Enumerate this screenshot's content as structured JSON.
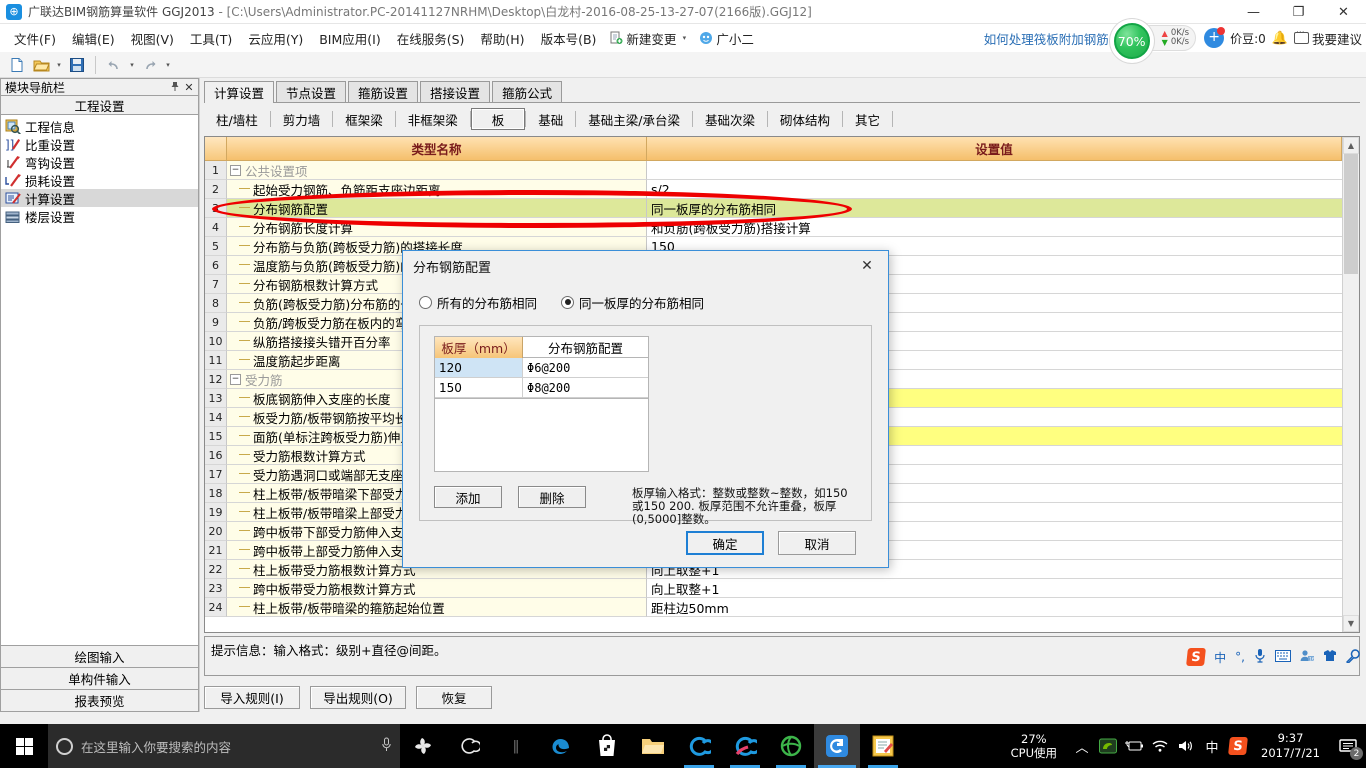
{
  "window": {
    "title_main": "广联达BIM钢筋算量软件 GGJ2013",
    "title_path": "- [C:\\Users\\Administrator.PC-20141127NRHM\\Desktop\\白龙村-2016-08-25-13-27-07(2166版).GGJ12]",
    "minimize": "—",
    "maximize": "❐",
    "close": "✕"
  },
  "menubar": {
    "items": [
      "文件(F)",
      "编辑(E)",
      "视图(V)",
      "工具(T)",
      "云应用(Y)",
      "BIM应用(I)",
      "在线服务(S)",
      "帮助(H)",
      "版本号(B)"
    ],
    "new_change": "新建变更",
    "new_change_caret": "▾",
    "assistant": "广小二",
    "hint_link": "如何处理筏板附加钢筋..",
    "net_up": "0K/s",
    "net_down": "0K/s",
    "gauge_percent": "70%",
    "bean_label": "价豆:0",
    "suggest_label": "我要建议"
  },
  "toolbar": {
    "new_icon": "new-file",
    "open_icon": "open-folder",
    "save_icon": "save-disk",
    "undo_icon": "undo-arrow",
    "redo_icon": "redo-arrow",
    "caret": "▾"
  },
  "sidebar": {
    "panel_title": "模块导航栏",
    "pin": "📌",
    "close": "✕",
    "section_title": "工程设置",
    "items": [
      {
        "label": "工程信息",
        "selected": false
      },
      {
        "label": "比重设置",
        "selected": false
      },
      {
        "label": "弯钩设置",
        "selected": false
      },
      {
        "label": "损耗设置",
        "selected": false
      },
      {
        "label": "计算设置",
        "selected": true
      },
      {
        "label": "楼层设置",
        "selected": false
      }
    ],
    "bottom_buttons": [
      "绘图输入",
      "单构件输入",
      "报表预览"
    ]
  },
  "tabs_primary": [
    {
      "label": "计算设置",
      "active": true
    },
    {
      "label": "节点设置",
      "active": false
    },
    {
      "label": "箍筋设置",
      "active": false
    },
    {
      "label": "搭接设置",
      "active": false
    },
    {
      "label": "箍筋公式",
      "active": false
    }
  ],
  "tabs_secondary": [
    {
      "label": "柱/墙柱",
      "active": false
    },
    {
      "label": "剪力墙",
      "active": false
    },
    {
      "label": "框架梁",
      "active": false
    },
    {
      "label": "非框架梁",
      "active": false
    },
    {
      "label": "板",
      "active": true
    },
    {
      "label": "基础",
      "active": false
    },
    {
      "label": "基础主梁/承台梁",
      "active": false
    },
    {
      "label": "基础次梁",
      "active": false
    },
    {
      "label": "砌体结构",
      "active": false
    },
    {
      "label": "其它",
      "active": false
    }
  ],
  "grid": {
    "col_name": "类型名称",
    "col_value": "设置值",
    "rows": [
      {
        "n": "1",
        "type": "group",
        "expander": "−",
        "name": "公共设置项",
        "value": ""
      },
      {
        "n": "2",
        "type": "item",
        "name": "起始受力钢筋、负筋距支座边距离",
        "value": "s/2"
      },
      {
        "n": "3",
        "type": "item",
        "name": "分布钢筋配置",
        "value": "同一板厚的分布筋相同",
        "state": "selected"
      },
      {
        "n": "4",
        "type": "item",
        "name": "分布钢筋长度计算",
        "value": "和负筋(跨板受力筋)搭接计算"
      },
      {
        "n": "5",
        "type": "item",
        "name": "分布筋与负筋(跨板受力筋)的搭接长度",
        "value": "150"
      },
      {
        "n": "6",
        "type": "item",
        "name": "温度筋与负筋(跨板受力筋)的搭接长度",
        "value": ""
      },
      {
        "n": "7",
        "type": "item",
        "name": "分布钢筋根数计算方式",
        "value": ""
      },
      {
        "n": "8",
        "type": "item",
        "name": "负筋(跨板受力筋)分布筋的长度计算",
        "value": ""
      },
      {
        "n": "9",
        "type": "item",
        "name": "负筋/跨板受力筋在板内的弯折长度",
        "value": ""
      },
      {
        "n": "10",
        "type": "item",
        "name": "纵筋搭接接头错开百分率",
        "value": ""
      },
      {
        "n": "11",
        "type": "item",
        "name": "温度筋起步距离",
        "value": ""
      },
      {
        "n": "12",
        "type": "group",
        "expander": "−",
        "name": "受力筋",
        "value": ""
      },
      {
        "n": "13",
        "type": "item",
        "name": "板底钢筋伸入支座的长度",
        "value": "",
        "state": "highlight"
      },
      {
        "n": "14",
        "type": "item",
        "name": "板受力筋/板带钢筋按平均长度计算",
        "value": ""
      },
      {
        "n": "15",
        "type": "item",
        "name": "面筋(单标注跨板受力筋)伸入支座的长度",
        "value": "",
        "state": "highlight"
      },
      {
        "n": "16",
        "type": "item",
        "name": "受力筋根数计算方式",
        "value": ""
      },
      {
        "n": "17",
        "type": "item",
        "name": "受力筋遇洞口或端部无支座时的弯折长度",
        "value": ""
      },
      {
        "n": "18",
        "type": "item",
        "name": "柱上板带/板带暗梁下部受力筋伸入支座的长度",
        "value": ""
      },
      {
        "n": "19",
        "type": "item",
        "name": "柱上板带/板带暗梁上部受力筋伸入支座的长度",
        "value": ""
      },
      {
        "n": "20",
        "type": "item",
        "name": "跨中板带下部受力筋伸入支座的长度",
        "value": ""
      },
      {
        "n": "21",
        "type": "item",
        "name": "跨中板带上部受力筋伸入支座的长度",
        "value": ""
      },
      {
        "n": "22",
        "type": "item",
        "name": "柱上板带受力筋根数计算方式",
        "value": "向上取整+1"
      },
      {
        "n": "23",
        "type": "item",
        "name": "跨中板带受力筋根数计算方式",
        "value": "向上取整+1"
      },
      {
        "n": "24",
        "type": "item",
        "name": "柱上板带/板带暗梁的箍筋起始位置",
        "value": "距柱边50mm"
      }
    ]
  },
  "tip": {
    "text": "提示信息：输入格式：级别+直径@间距。"
  },
  "footer_buttons": [
    "导入规则(I)",
    "导出规则(O)",
    "恢复"
  ],
  "dialog": {
    "title": "分布钢筋配置",
    "close": "✕",
    "radio_all": "所有的分布筋相同",
    "radio_same_thickness": "同一板厚的分布筋相同",
    "selected_radio": "same_thickness",
    "table": {
      "col_thickness": "板厚（mm）",
      "col_config": "分布钢筋配置",
      "rows": [
        {
          "thickness": "120",
          "config": "Φ6@200",
          "selected": true
        },
        {
          "thickness": "150",
          "config": "Φ8@200",
          "selected": false
        }
      ]
    },
    "btn_add": "添加",
    "btn_delete": "删除",
    "hint": "板厚输入格式：整数或整数~整数，如150或150 200. 板厚范围不允许重叠，板厚(0,5000]整数。",
    "btn_ok": "确定",
    "btn_cancel": "取消"
  },
  "ime": {
    "lang": "中",
    "punct": "°,",
    "mic": "mic-icon",
    "keyboard": "keyboard-icon",
    "user": "user-icon",
    "shirt": "shirt-icon",
    "wrench": "wrench-icon",
    "sogou": "S"
  },
  "taskbar": {
    "search_placeholder": "在这里输入你要搜索的内容",
    "cpu_percent": "27%",
    "cpu_label": "CPU使用",
    "time": "9:37",
    "date": "2017/7/21",
    "notif_count": "2",
    "lang": "中"
  },
  "colors": {
    "accent_blue": "#1e7fd4",
    "header_orange": "#f5bf6b",
    "selected_row": "#dde89a",
    "highlight_row": "#ffff80",
    "annotation_red": "#ee0000",
    "gauge_green": "#2fc35c"
  }
}
